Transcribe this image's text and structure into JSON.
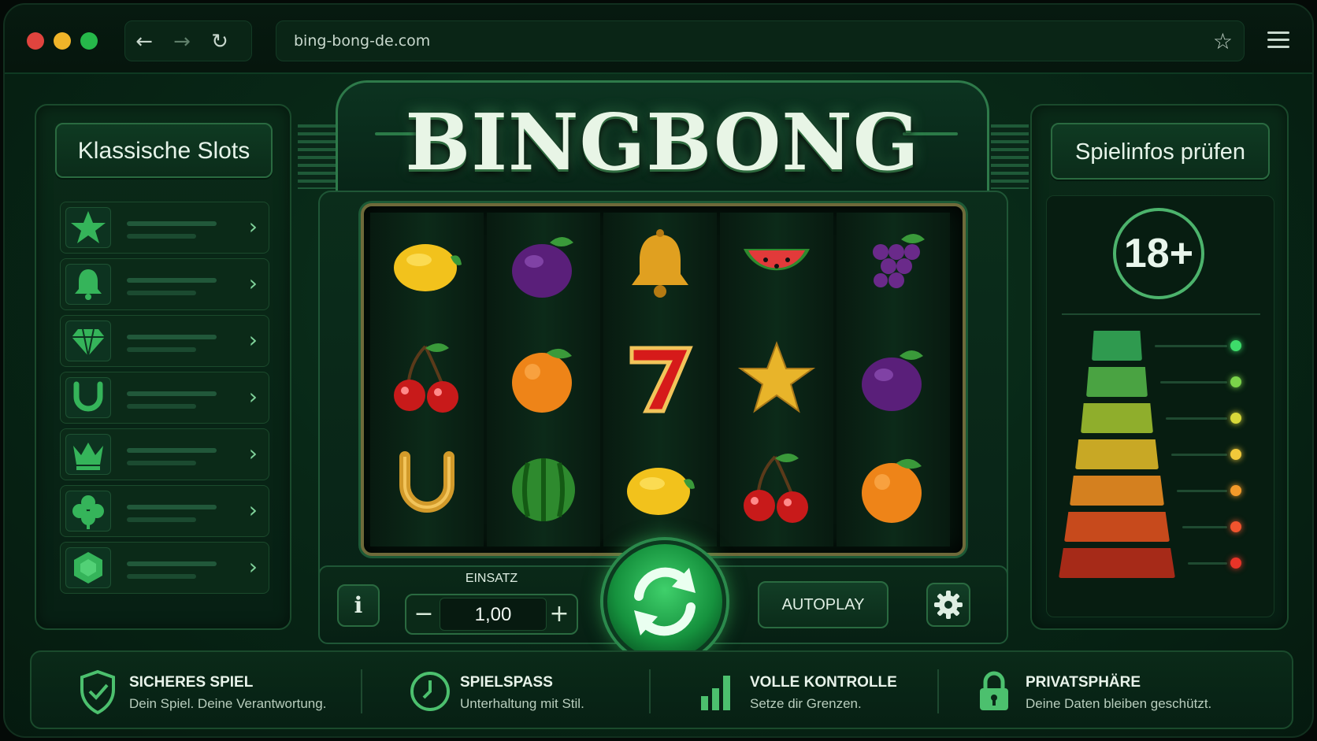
{
  "browser": {
    "url": "bing-bong-de.com",
    "back_icon": "arrow-left-icon",
    "forward_icon": "arrow-right-icon",
    "reload_icon": "reload-icon",
    "bookmark_icon": "star-outline-icon",
    "menu_icon": "hamburger-icon",
    "traffic_lights": [
      "#e0443e",
      "#f0b429",
      "#26b84a"
    ]
  },
  "left_panel": {
    "title": "Klassische Slots",
    "items": [
      {
        "icon": "star-icon"
      },
      {
        "icon": "bell-icon"
      },
      {
        "icon": "diamond-icon"
      },
      {
        "icon": "horseshoe-icon"
      },
      {
        "icon": "crown-icon"
      },
      {
        "icon": "clover-icon"
      },
      {
        "icon": "gem-icon"
      }
    ]
  },
  "machine": {
    "title": "BINGBONG",
    "reels": [
      [
        "lemon",
        "cherry",
        "horseshoe"
      ],
      [
        "plum",
        "orange",
        "watermelon"
      ],
      [
        "bell",
        "seven",
        "lemon"
      ],
      [
        "watermelon-slice",
        "star",
        "cherry"
      ],
      [
        "grapes",
        "plum",
        "orange"
      ]
    ],
    "info_label": "i",
    "stake_label": "EINSATZ",
    "stake_value": "1,00",
    "minus": "−",
    "plus": "+",
    "spin_icon": "spin-arrows-icon",
    "autoplay_label": "AUTOPLAY",
    "settings_icon": "gear-icon"
  },
  "right_panel": {
    "title": "Spielinfos prüfen",
    "age_badge": "18+",
    "risk_levels": [
      {
        "color": "#2f9a4f",
        "dot": "#3ddc6a"
      },
      {
        "color": "#4aa342",
        "dot": "#7bd34a"
      },
      {
        "color": "#8fae2c",
        "dot": "#d8d83a"
      },
      {
        "color": "#c8a825",
        "dot": "#f1c83a"
      },
      {
        "color": "#d4801f",
        "dot": "#f39a2a"
      },
      {
        "color": "#c74a1c",
        "dot": "#f0542e"
      },
      {
        "color": "#a62a18",
        "dot": "#e83428"
      }
    ]
  },
  "features": [
    {
      "icon": "shield-check-icon",
      "title": "SICHERES SPIEL",
      "subtitle": "Dein Spiel. Deine Verantwortung."
    },
    {
      "icon": "clock-icon",
      "title": "SPIELSPASS",
      "subtitle": "Unterhaltung mit Stil."
    },
    {
      "icon": "bar-chart-icon",
      "title": "VOLLE KONTROLLE",
      "subtitle": "Setze dir Grenzen."
    },
    {
      "icon": "lock-icon",
      "title": "PRIVATSPHÄRE",
      "subtitle": "Deine Daten bleiben geschützt."
    }
  ]
}
